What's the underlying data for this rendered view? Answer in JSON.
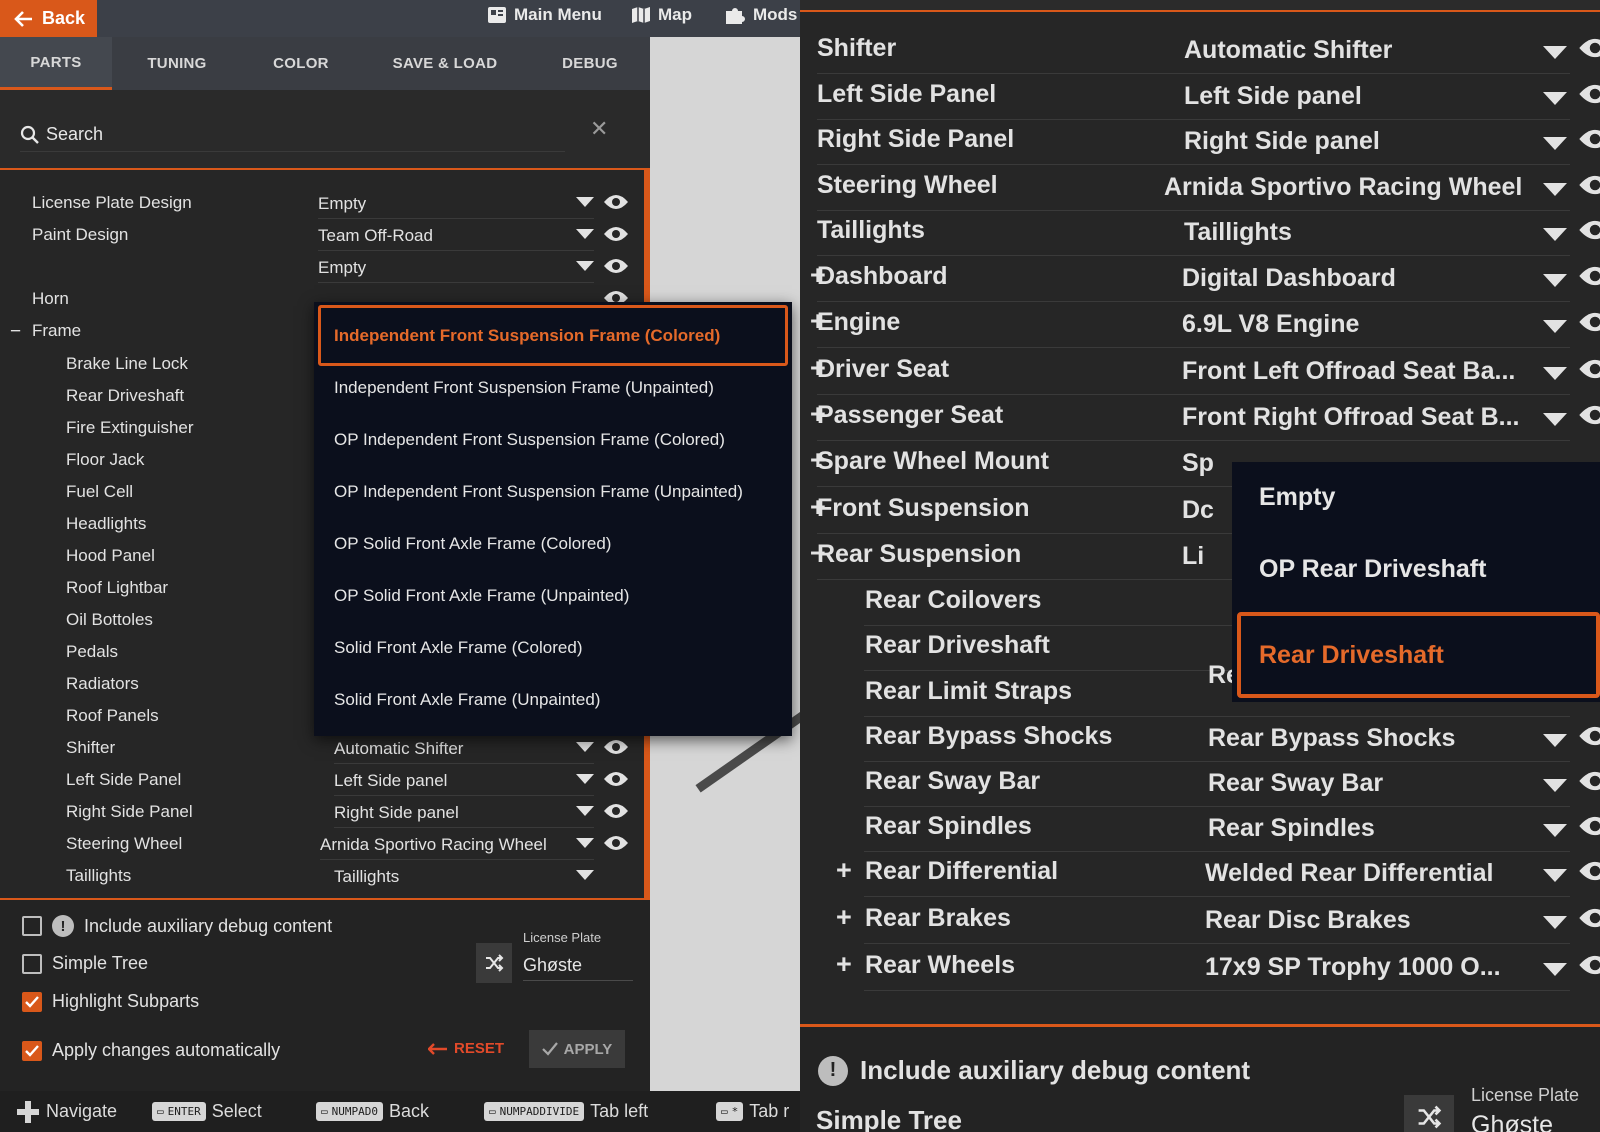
{
  "topbar": {
    "back_label": "Back",
    "main_menu_label": "Main Menu",
    "map_label": "Map",
    "mods_label": "Mods"
  },
  "tabs": [
    {
      "label": "PARTS",
      "active": true
    },
    {
      "label": "TUNING",
      "active": false
    },
    {
      "label": "COLOR",
      "active": false
    },
    {
      "label": "SAVE & LOAD",
      "active": false
    },
    {
      "label": "DEBUG",
      "active": false
    }
  ],
  "search": {
    "placeholder": "Search",
    "value": ""
  },
  "tree": {
    "rows": [
      {
        "label": "License Plate Design",
        "value": "Empty"
      },
      {
        "label": "Paint Design",
        "value": "Team Off-Road"
      },
      {
        "label": "",
        "value": "Empty"
      },
      {
        "label": "Horn",
        "value": ""
      },
      {
        "label": "Frame",
        "value": ""
      },
      {
        "label": "Brake Line Lock",
        "value": ""
      },
      {
        "label": "Rear Driveshaft",
        "value": ""
      },
      {
        "label": "Fire Extinguisher",
        "value": ""
      },
      {
        "label": "Floor Jack",
        "value": ""
      },
      {
        "label": "Fuel Cell",
        "value": ""
      },
      {
        "label": "Headlights",
        "value": ""
      },
      {
        "label": "Hood Panel",
        "value": ""
      },
      {
        "label": "Roof Lightbar",
        "value": ""
      },
      {
        "label": "Oil Bottoles",
        "value": ""
      },
      {
        "label": "Pedals",
        "value": ""
      },
      {
        "label": "Radiators",
        "value": ""
      },
      {
        "label": "Roof Panels",
        "value": ""
      },
      {
        "label": "Shifter",
        "value": "Automatic Shifter"
      },
      {
        "label": "Left Side Panel",
        "value": "Left Side panel"
      },
      {
        "label": "Right Side Panel",
        "value": "Right Side panel"
      },
      {
        "label": "Steering Wheel",
        "value": "Arnida Sportivo Racing Wheel"
      },
      {
        "label": "Taillights",
        "value": "Taillights"
      }
    ],
    "frame_dropdown": {
      "options": [
        "Independent Front Suspension Frame (Colored)",
        "Independent Front Suspension Frame (Unpainted)",
        "OP Independent Front Suspension Frame (Colored)",
        "OP Independent Front Suspension Frame (Unpainted)",
        "OP Solid Front Axle Frame (Colored)",
        "OP Solid Front Axle Frame (Unpainted)",
        "Solid Front Axle Frame (Colored)",
        "Solid Front Axle Frame (Unpainted)"
      ],
      "selected": "Independent Front Suspension Frame (Colored)"
    }
  },
  "options": {
    "aux_debug_label": "Include auxiliary debug content",
    "aux_debug_checked": false,
    "simple_tree_label": "Simple Tree",
    "simple_tree_checked": false,
    "highlight_label": "Highlight Subparts",
    "highlight_checked": true,
    "auto_apply_label": "Apply changes automatically",
    "auto_apply_checked": true,
    "license_plate_label": "License Plate",
    "license_plate_value": "Ghøste",
    "reset_label": "RESET",
    "apply_label": "APPLY"
  },
  "hints": [
    {
      "icon": "dpad-icon",
      "key": "",
      "label": "Navigate"
    },
    {
      "icon": "keyboard-icon",
      "key": "ENTER",
      "label": "Select"
    },
    {
      "icon": "keyboard-icon",
      "key": "NUMPAD0",
      "label": "Back"
    },
    {
      "icon": "keyboard-icon",
      "key": "NUMPADDIVIDE",
      "label": "Tab left"
    },
    {
      "icon": "keyboard-icon",
      "key": "*",
      "label": "Tab r"
    }
  ],
  "zoom": {
    "top_clipped_value": "Roof Panels",
    "rows": [
      {
        "label": "Shifter",
        "value": "Automatic Shifter",
        "expand": ""
      },
      {
        "label": "Left Side Panel",
        "value": "Left Side panel",
        "expand": ""
      },
      {
        "label": "Right Side Panel",
        "value": "Right Side panel",
        "expand": ""
      },
      {
        "label": "Steering Wheel",
        "value": "Arnida Sportivo Racing Wheel",
        "expand": ""
      },
      {
        "label": "Taillights",
        "value": "Taillights",
        "expand": ""
      },
      {
        "label": "Dashboard",
        "value": "Digital Dashboard",
        "expand": "+"
      },
      {
        "label": "Engine",
        "value": "6.9L V8 Engine",
        "expand": "+"
      },
      {
        "label": "Driver Seat",
        "value": "Front Left Offroad Seat Ba...",
        "expand": "+"
      },
      {
        "label": "Passenger Seat",
        "value": "Front Right Offroad Seat B...",
        "expand": "+"
      },
      {
        "label": "Spare Wheel Mount",
        "value": "Sp",
        "expand": "+"
      },
      {
        "label": "Front Suspension",
        "value": "Dc",
        "expand": "+"
      },
      {
        "label": "Rear Suspension",
        "value": "Li",
        "expand": "−"
      },
      {
        "label": "Rear Coilovers",
        "value": "",
        "expand": ""
      },
      {
        "label": "Rear Driveshaft",
        "value": "",
        "expand": ""
      },
      {
        "label": "Rear Limit Straps",
        "value": "Rear Limit Straps",
        "expand": ""
      },
      {
        "label": "Rear Bypass Shocks",
        "value": "Rear Bypass Shocks",
        "expand": ""
      },
      {
        "label": "Rear Sway Bar",
        "value": "Rear Sway Bar",
        "expand": ""
      },
      {
        "label": "Rear Spindles",
        "value": "Rear Spindles",
        "expand": ""
      },
      {
        "label": "Rear Differential",
        "value": "Welded Rear Differential",
        "expand": "+"
      },
      {
        "label": "Rear Brakes",
        "value": "Rear Disc Brakes",
        "expand": "+"
      },
      {
        "label": "Rear Wheels",
        "value": "17x9 SP Trophy 1000 O...",
        "expand": "+"
      }
    ],
    "driveshaft_dropdown": {
      "options": [
        "Empty",
        "OP Rear Driveshaft",
        "Rear Driveshaft"
      ],
      "selected": "Rear Driveshaft"
    },
    "footer": {
      "aux_debug_label": "Include auxiliary debug content",
      "simple_tree_label": "Simple Tree",
      "license_plate_label": "License Plate",
      "license_plate_value": "Ghøste"
    }
  },
  "colors": {
    "accent": "#d9581a",
    "dropdown_bg": "#0b0f1c",
    "panel_bg": "#262626"
  }
}
